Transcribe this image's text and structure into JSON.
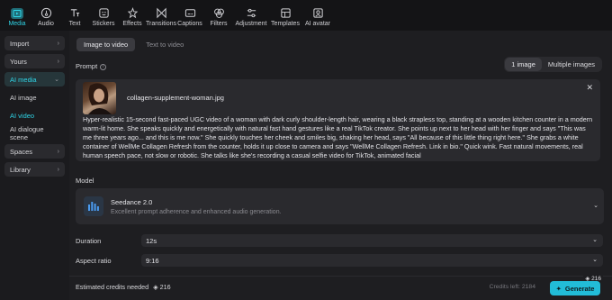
{
  "toolbar": [
    {
      "label": "Media",
      "icon": "media-icon",
      "active": true
    },
    {
      "label": "Audio",
      "icon": "audio-icon"
    },
    {
      "label": "Text",
      "icon": "text-icon"
    },
    {
      "label": "Stickers",
      "icon": "stickers-icon"
    },
    {
      "label": "Effects",
      "icon": "effects-icon"
    },
    {
      "label": "Transitions",
      "icon": "transitions-icon"
    },
    {
      "label": "Captions",
      "icon": "captions-icon"
    },
    {
      "label": "Filters",
      "icon": "filters-icon"
    },
    {
      "label": "Adjustment",
      "icon": "adjustment-icon"
    },
    {
      "label": "Templates",
      "icon": "templates-icon"
    },
    {
      "label": "AI avatar",
      "icon": "ai-avatar-icon"
    }
  ],
  "sidebar": {
    "import": "Import",
    "yours": "Yours",
    "ai_media": "AI media",
    "ai_image": "AI image",
    "ai_video": "AI video",
    "ai_dialogue": "AI dialogue scene",
    "spaces": "Spaces",
    "library": "Library"
  },
  "tabs": {
    "image_to_video": "Image to video",
    "text_to_video": "Text to video"
  },
  "prompt": {
    "label": "Prompt",
    "modes": [
      "1 image",
      "Multiple images"
    ],
    "filename": "collagen-supplement-woman.jpg",
    "text": "Hyper-realistic 15-second fast-paced UGC video of a woman with dark curly shoulder-length hair, wearing a black strapless top, standing at a wooden kitchen counter in a modern warm-lit home. She speaks quickly and energetically with natural fast hand gestures like a real TikTok creator. She points up next to her head with her finger and says \"This was me three years ago... and this is me now.\" She quickly touches her cheek and smiles big, shaking her head, says \"All because of this little thing right here.\" She grabs a white container of WellMe Collagen Refresh from the counter, holds it up close to camera and says \"WellMe Collagen Refresh. Link in bio.\" Quick wink. Fast natural movements, real human speech pace, not slow or robotic. She talks like she's recording a casual selfie video for TikTok, animated facial"
  },
  "model": {
    "label": "Model",
    "name": "Seedance 2.0",
    "description": "Excellent prompt adherence and enhanced audio generation."
  },
  "duration": {
    "label": "Duration",
    "value": "12s"
  },
  "aspect_ratio": {
    "label": "Aspect ratio",
    "value": "9:16"
  },
  "footer": {
    "estimated_label": "Estimated credits needed",
    "estimated_value": "216",
    "credits_left": "Credits left: 2184",
    "generate_label": "Generate",
    "generate_badge": "216"
  },
  "colors": {
    "accent": "#2fd4e6",
    "generate": "#22bcd8"
  }
}
